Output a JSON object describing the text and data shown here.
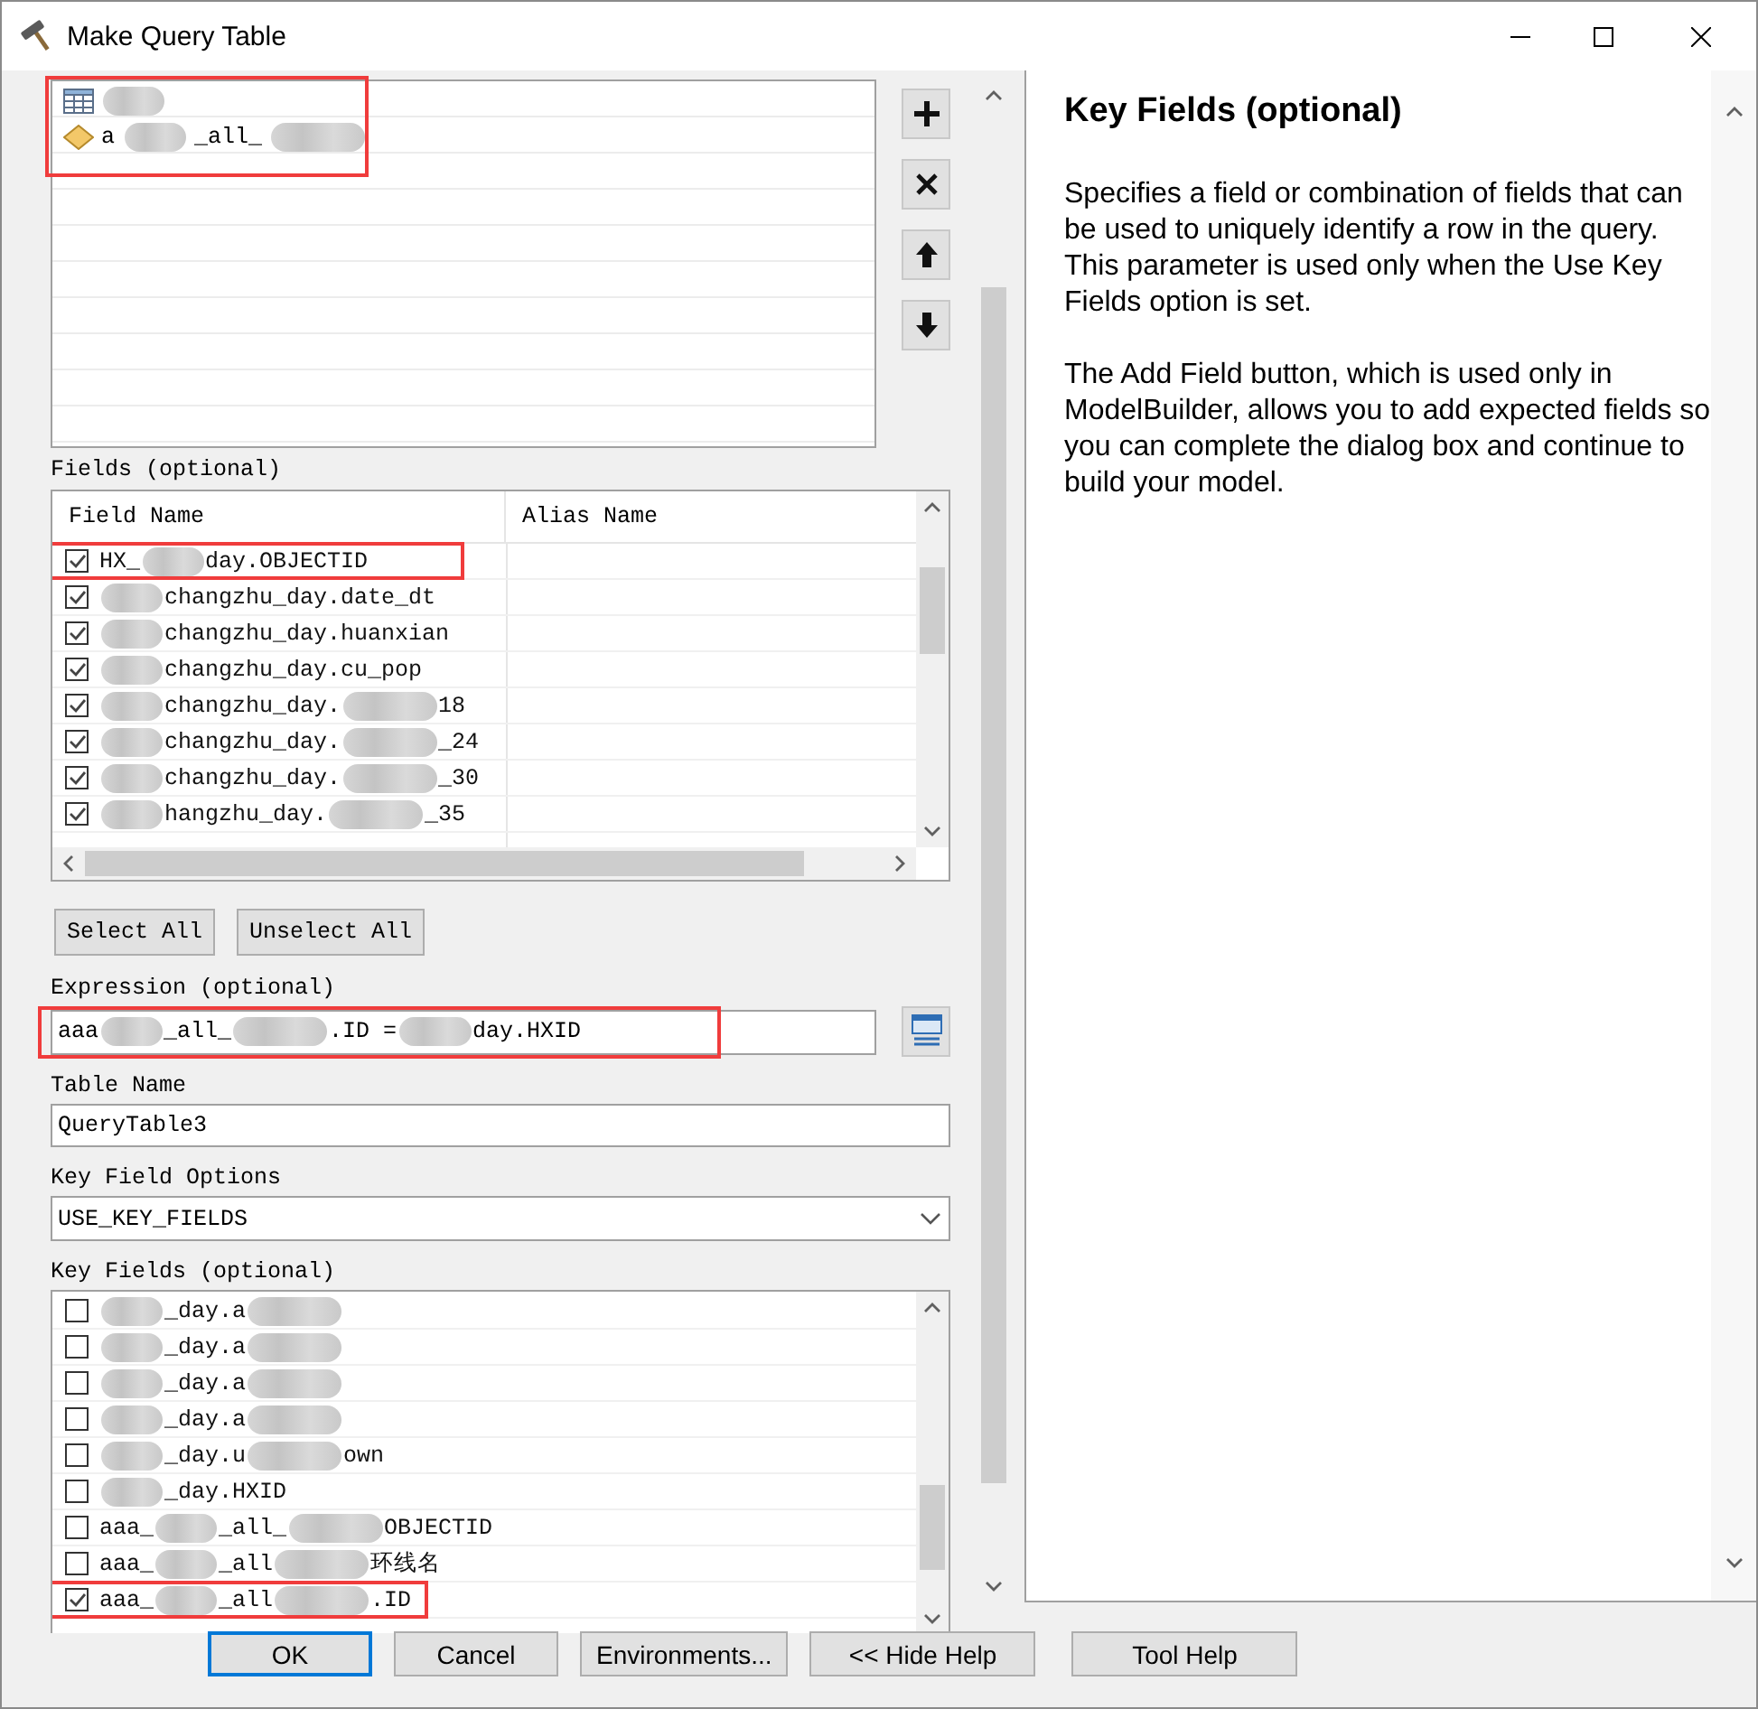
{
  "window": {
    "title": "Make Query Table"
  },
  "input_tables": {
    "highlighted": true,
    "items": [
      {
        "kind": "table",
        "name": [
          {
            "kind": "redacted"
          }
        ]
      },
      {
        "kind": "feature_class",
        "name": [
          {
            "kind": "text",
            "text": "a"
          },
          {
            "kind": "redacted"
          },
          {
            "kind": "text",
            "text": "_all_"
          },
          {
            "kind": "redacted"
          }
        ]
      }
    ]
  },
  "list_buttons": [
    {
      "kind": "add"
    },
    {
      "kind": "remove"
    },
    {
      "kind": "up"
    },
    {
      "kind": "down"
    }
  ],
  "fields": {
    "label": "Fields (optional)",
    "columns": [
      "Field Name",
      "Alias Name"
    ],
    "rows": [
      {
        "checked": true,
        "highlighted": true,
        "name": [
          {
            "kind": "text",
            "text": "HX_"
          },
          {
            "kind": "redacted"
          },
          {
            "kind": "text",
            "text": "day.OBJECTID"
          }
        ]
      },
      {
        "checked": true,
        "highlighted": false,
        "name": [
          {
            "kind": "redacted"
          },
          {
            "kind": "text",
            "text": "changzhu_day.date_dt"
          }
        ]
      },
      {
        "checked": true,
        "highlighted": false,
        "name": [
          {
            "kind": "redacted"
          },
          {
            "kind": "text",
            "text": "changzhu_day.huanxian"
          }
        ]
      },
      {
        "checked": true,
        "highlighted": false,
        "name": [
          {
            "kind": "redacted"
          },
          {
            "kind": "text",
            "text": "changzhu_day.cu_pop"
          }
        ]
      },
      {
        "checked": true,
        "highlighted": false,
        "name": [
          {
            "kind": "redacted"
          },
          {
            "kind": "text",
            "text": "changzhu_day."
          },
          {
            "kind": "redacted"
          },
          {
            "kind": "text",
            "text": "18"
          }
        ]
      },
      {
        "checked": true,
        "highlighted": false,
        "name": [
          {
            "kind": "redacted"
          },
          {
            "kind": "text",
            "text": "changzhu_day."
          },
          {
            "kind": "redacted"
          },
          {
            "kind": "text",
            "text": "_24"
          }
        ]
      },
      {
        "checked": true,
        "highlighted": false,
        "name": [
          {
            "kind": "redacted"
          },
          {
            "kind": "text",
            "text": "changzhu_day."
          },
          {
            "kind": "redacted"
          },
          {
            "kind": "text",
            "text": "_30"
          }
        ]
      },
      {
        "checked": true,
        "highlighted": false,
        "name": [
          {
            "kind": "redacted"
          },
          {
            "kind": "text",
            "text": "hangzhu_day."
          },
          {
            "kind": "redacted"
          },
          {
            "kind": "text",
            "text": "_35"
          }
        ]
      }
    ]
  },
  "select_buttons": [
    "Select All",
    "Unselect All"
  ],
  "expression": {
    "label": "Expression (optional)",
    "highlighted": true,
    "value": [
      {
        "kind": "text",
        "text": "aaa"
      },
      {
        "kind": "redacted"
      },
      {
        "kind": "text",
        "text": "_all_"
      },
      {
        "kind": "redacted"
      },
      {
        "kind": "text",
        "text": ".ID ="
      },
      {
        "kind": "redacted"
      },
      {
        "kind": "text",
        "text": "day.HXID"
      }
    ]
  },
  "table_name": {
    "label": "Table Name",
    "value": "QueryTable3"
  },
  "key_field_options": {
    "label": "Key Field Options",
    "value": "USE_KEY_FIELDS"
  },
  "key_fields": {
    "label": "Key Fields (optional)",
    "rows": [
      {
        "checked": false,
        "highlighted": false,
        "name": [
          {
            "kind": "redacted"
          },
          {
            "kind": "text",
            "text": "_day.a"
          },
          {
            "kind": "redacted"
          }
        ]
      },
      {
        "checked": false,
        "highlighted": false,
        "name": [
          {
            "kind": "redacted"
          },
          {
            "kind": "text",
            "text": "_day.a"
          },
          {
            "kind": "redacted"
          }
        ]
      },
      {
        "checked": false,
        "highlighted": false,
        "name": [
          {
            "kind": "redacted"
          },
          {
            "kind": "text",
            "text": "_day.a"
          },
          {
            "kind": "redacted"
          }
        ]
      },
      {
        "checked": false,
        "highlighted": false,
        "name": [
          {
            "kind": "redacted"
          },
          {
            "kind": "text",
            "text": "_day.a"
          },
          {
            "kind": "redacted"
          }
        ]
      },
      {
        "checked": false,
        "highlighted": false,
        "name": [
          {
            "kind": "redacted"
          },
          {
            "kind": "text",
            "text": "_day.u"
          },
          {
            "kind": "redacted"
          },
          {
            "kind": "text",
            "text": "own"
          }
        ]
      },
      {
        "checked": false,
        "highlighted": false,
        "name": [
          {
            "kind": "redacted"
          },
          {
            "kind": "text",
            "text": "_day.HXID"
          }
        ]
      },
      {
        "checked": false,
        "highlighted": false,
        "name": [
          {
            "kind": "text",
            "text": "aaa_"
          },
          {
            "kind": "redacted"
          },
          {
            "kind": "text",
            "text": "_all_"
          },
          {
            "kind": "redacted"
          },
          {
            "kind": "text",
            "text": "OBJECTID"
          }
        ]
      },
      {
        "checked": false,
        "highlighted": false,
        "name": [
          {
            "kind": "text",
            "text": "aaa_"
          },
          {
            "kind": "redacted"
          },
          {
            "kind": "text",
            "text": "_all"
          },
          {
            "kind": "redacted"
          },
          {
            "kind": "text",
            "text": "环线名"
          }
        ]
      },
      {
        "checked": true,
        "highlighted": true,
        "name": [
          {
            "kind": "text",
            "text": "aaa_"
          },
          {
            "kind": "redacted"
          },
          {
            "kind": "text",
            "text": "_all"
          },
          {
            "kind": "redacted"
          },
          {
            "kind": "text",
            "text": ".ID"
          }
        ]
      }
    ]
  },
  "help": {
    "title": "Key Fields (optional)",
    "paragraphs": [
      "Specifies a field or combination of fields that can be used to uniquely identify a row in the query. This parameter is used only when the Use Key Fields option is set.",
      "The Add Field button, which is used only in ModelBuilder, allows you to add expected fields so you can complete the dialog box and continue to build your model."
    ]
  },
  "buttons": [
    {
      "label": "OK",
      "default": true
    },
    {
      "label": "Cancel",
      "default": false
    },
    {
      "label": "Environments...",
      "default": false
    },
    {
      "label": "<< Hide Help",
      "default": false
    },
    {
      "label": "Tool Help",
      "default": false
    }
  ]
}
